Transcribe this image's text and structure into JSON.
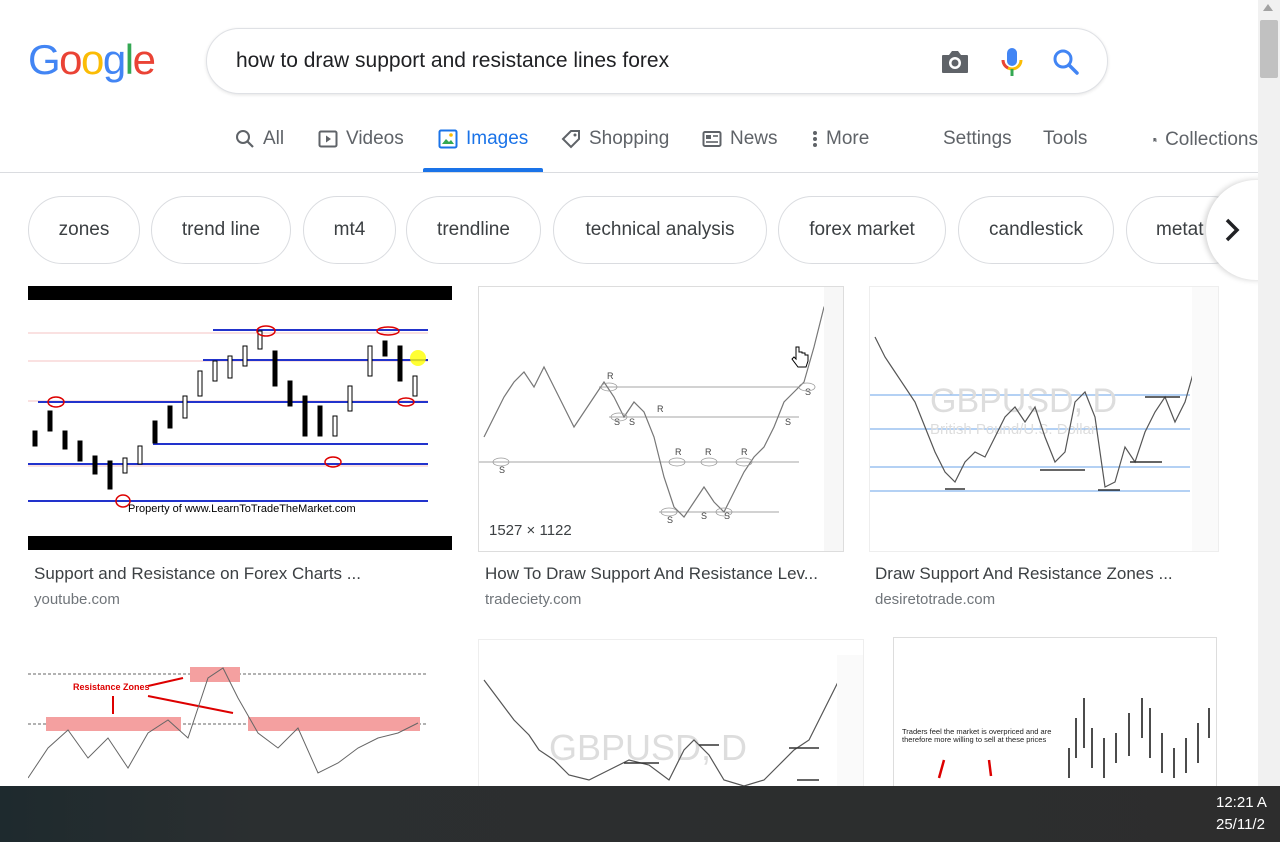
{
  "search": {
    "query": "how to draw support and resistance lines forex"
  },
  "tabs": [
    {
      "label": "All",
      "icon": "search-icon"
    },
    {
      "label": "Videos",
      "icon": "play-icon"
    },
    {
      "label": "Images",
      "icon": "image-icon",
      "active": true
    },
    {
      "label": "Shopping",
      "icon": "tag-icon"
    },
    {
      "label": "News",
      "icon": "news-icon"
    },
    {
      "label": "More",
      "icon": "kebab-icon"
    }
  ],
  "tools": {
    "settings": "Settings",
    "tools": "Tools",
    "collections": "Collections"
  },
  "chips": [
    "zones",
    "trend line",
    "mt4",
    "trendline",
    "technical analysis",
    "forex market",
    "candlestick",
    "metat"
  ],
  "results": [
    {
      "caption": "Support and Resistance on Forex Charts ...",
      "source": "youtube.com",
      "watermark": "Property of www.LearnToTradeTheMarket.com"
    },
    {
      "caption": "How To Draw Support And Resistance Lev...",
      "source": "tradeciety.com",
      "dimensions": "1527 × 1122"
    },
    {
      "caption": "Draw Support And Resistance Zones ...",
      "source": "desiretotrade.com",
      "watermark": "GBPUSD, D",
      "watermark2": "British Pound/U.S. Dollar"
    },
    {
      "caption": "",
      "source": "",
      "label": "Resistance Zones"
    },
    {
      "caption": "",
      "source": "",
      "watermark": "GBPUSD, D"
    },
    {
      "caption": "",
      "source": "",
      "note": "Traders feel the market is overpriced and are therefore more willing to sell at these prices"
    }
  ],
  "taskbar": {
    "time": "12:21 A",
    "date": "25/11/2"
  },
  "colors": {
    "accent": "#1a73e8",
    "google_blue": "#4285f4",
    "google_red": "#ea4335",
    "google_yellow": "#fbbc05",
    "google_green": "#34a853"
  }
}
